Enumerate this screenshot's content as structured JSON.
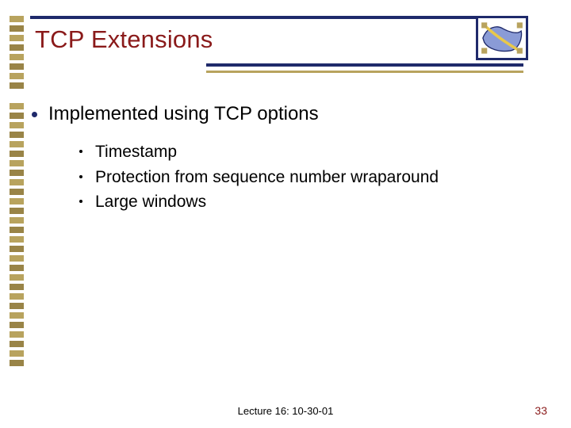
{
  "title": "TCP Extensions",
  "main_bullet": "Implemented using TCP options",
  "sub_bullets": [
    "Timestamp",
    "Protection from sequence number wraparound",
    "Large windows"
  ],
  "footer": {
    "center": "Lecture 16: 10-30-01",
    "page_number": "33"
  }
}
